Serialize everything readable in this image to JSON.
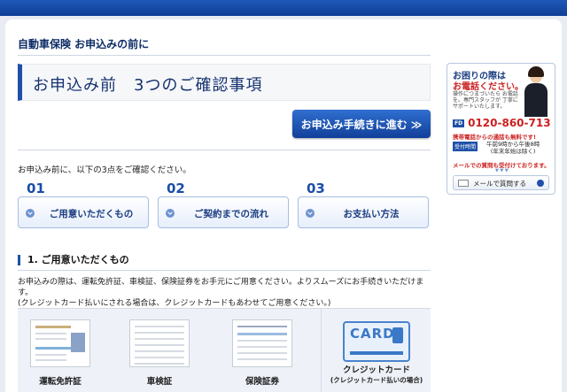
{
  "breadcrumb": "自動車保険 お申込みの前に",
  "page_title": "お申込み前　3つのご確認事項",
  "proceed_button": "お申込み手続きに進む ≫",
  "intro": "お申込み前に、以下の3点をご確認ください。",
  "steps": [
    {
      "num": "01",
      "label": "ご用意いただくもの"
    },
    {
      "num": "02",
      "label": "ご契約までの流れ"
    },
    {
      "num": "03",
      "label": "お支払い方法"
    }
  ],
  "section1": {
    "heading": "1. ご用意いただくもの",
    "desc_line1": "お申込みの際は、運転免許証、車検証、保険証券をお手元にご用意ください。よりスムーズにお手続きいただけます。",
    "desc_line2": "(クレジットカード払いにされる場合は、クレジットカードもあわせてご用意ください。)",
    "docs": [
      {
        "label": "運転免許証"
      },
      {
        "label": "車検証"
      },
      {
        "label": "保険証券"
      },
      {
        "label": "クレジットカード",
        "sub": "(クレジットカード払いの場合)",
        "card_text": "CARD"
      }
    ]
  },
  "sidebar": {
    "heading1": "お困りの際は",
    "heading2": "お電話ください。",
    "sub": "操作につまづいたら お電話を。専門スタッフが 丁寧にサポートいたします。",
    "freedial_tag": "FD",
    "phone": "0120-860-713",
    "free_note": "携帯電話からの通話も無料です!",
    "hours_tag": "受付時間",
    "hours_line1": "午前9時から午後8時",
    "hours_line2": "(年末年始は除く)",
    "mail_note": "メールでの質問も受付けております。",
    "arrows": "▼ ▼ ▼",
    "mail_button": "メールで質問する"
  },
  "colors": {
    "accent": "#1e50a8",
    "alert": "#cc1f1f",
    "top_bar": "#1a4fae"
  }
}
